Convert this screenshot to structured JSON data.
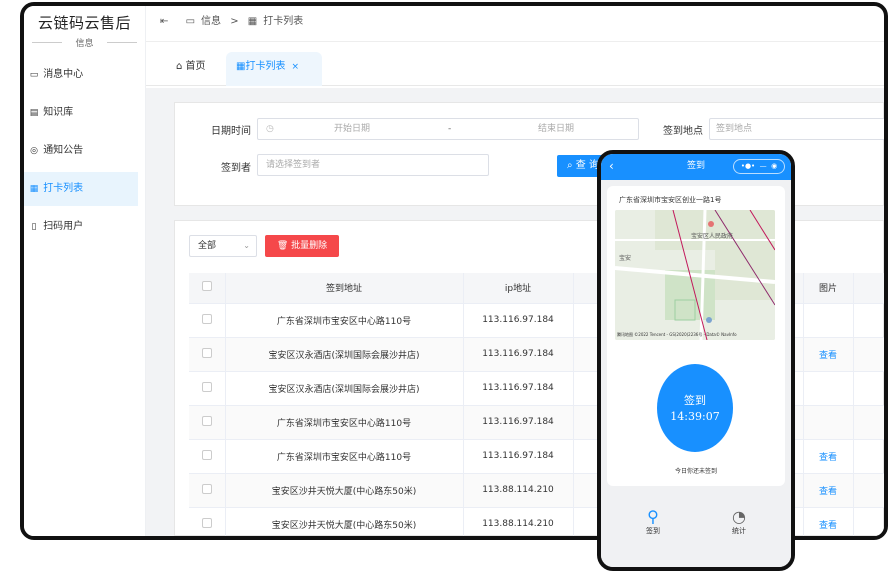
{
  "app": {
    "title": "云链码云售后",
    "subtitle": "信息"
  },
  "sidebar": {
    "items": [
      {
        "label": "消息中心",
        "icon": "message-icon"
      },
      {
        "label": "知识库",
        "icon": "book-icon"
      },
      {
        "label": "通知公告",
        "icon": "bell-icon"
      },
      {
        "label": "打卡列表",
        "icon": "calendar-icon",
        "active": true
      },
      {
        "label": "扫码用户",
        "icon": "user-icon"
      }
    ]
  },
  "breadcrumb": {
    "part1": "信息",
    "sep": ">",
    "part2": "打卡列表"
  },
  "tabs": {
    "home": "首页",
    "active": "打卡列表",
    "close": "×"
  },
  "filters": {
    "date_label": "日期时间",
    "start_placeholder": "开始日期",
    "dash": "-",
    "end_placeholder": "结束日期",
    "location_label": "签到地点",
    "location_placeholder": "签到地点",
    "signer_label": "签到者",
    "signer_placeholder": "请选择签到者",
    "query_label": "查 询"
  },
  "toolbar": {
    "filter_value": "全部",
    "batch_delete": "批量删除"
  },
  "table": {
    "headers": [
      "签到地址",
      "ip地址",
      "",
      "图片"
    ],
    "rows": [
      {
        "address": "广东省深圳市宝安区中心路110号",
        "ip": "113.116.97.184",
        "image": ""
      },
      {
        "address": "宝安区汉永酒店(深圳国际会展沙井店)",
        "ip": "113.116.97.184",
        "image": "查看"
      },
      {
        "address": "宝安区汉永酒店(深圳国际会展沙井店)",
        "ip": "113.116.97.184",
        "image": ""
      },
      {
        "address": "广东省深圳市宝安区中心路110号",
        "ip": "113.116.97.184",
        "image": ""
      },
      {
        "address": "广东省深圳市宝安区中心路110号",
        "ip": "113.116.97.184",
        "image": "查看"
      },
      {
        "address": "宝安区沙井天悦大厦(中心路东50米)",
        "ip": "113.88.114.210",
        "image": "查看"
      },
      {
        "address": "宝安区沙井天悦大厦(中心路东50米)",
        "ip": "113.88.114.210",
        "image": "查看"
      }
    ]
  },
  "phone": {
    "title": "签到",
    "address": "广东省深圳市宝安区创业一路1号",
    "map_label": "宝安区人民政府",
    "map_label2": "宝安",
    "map_credit": "腾讯地图 ©2022 Tencent - GS(2020)2236号 - Data© NavInfo",
    "sign_text": "签到",
    "time": "14:39:07",
    "hint": "今日你还未签到",
    "nav_sign": "签到",
    "nav_stats": "统计"
  },
  "colors": {
    "primary": "#1890ff",
    "danger": "#f5484a"
  }
}
